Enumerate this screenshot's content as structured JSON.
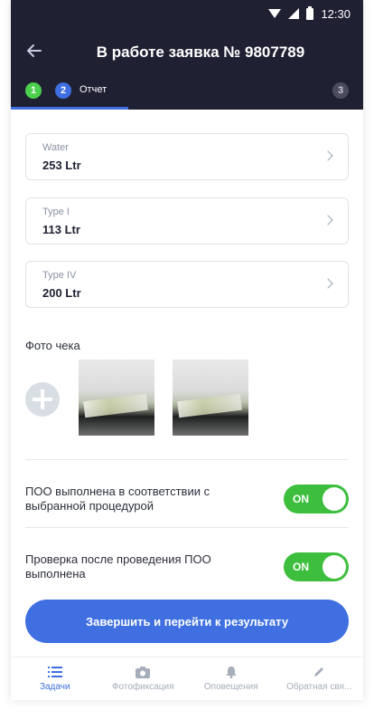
{
  "status_bar": {
    "time": "12:30"
  },
  "header": {
    "title": "В работе заявка № 9807789",
    "steps": [
      {
        "number": "1",
        "state": "done"
      },
      {
        "number": "2",
        "label": "Отчет",
        "state": "active"
      },
      {
        "number": "3",
        "state": "pending"
      }
    ]
  },
  "fields": [
    {
      "label": "Water",
      "value": "253 Ltr"
    },
    {
      "label": "Type I",
      "value": "113 Ltr"
    },
    {
      "label": "Type IV",
      "value": "200 Ltr"
    }
  ],
  "photos": {
    "title": "Фото чека",
    "count": 2
  },
  "toggles": [
    {
      "label": "ПОО  выполнена в соответствии с выбранной процедурой",
      "state": "ON"
    },
    {
      "label": "Проверка после проведения ПОО выполнена",
      "state": "ON"
    }
  ],
  "primary_button": {
    "label": "Завершить и перейти к результату"
  },
  "tabbar": {
    "items": [
      {
        "label": "Задачи",
        "icon": "list-icon",
        "active": true
      },
      {
        "label": "Фотофиксация",
        "icon": "camera-icon",
        "active": false
      },
      {
        "label": "Оповещения",
        "icon": "bell-icon",
        "active": false
      },
      {
        "label": "Обратная свя...",
        "icon": "pencil-icon",
        "active": false
      }
    ]
  },
  "colors": {
    "header_bg": "#1f2133",
    "accent": "#3f6fe0",
    "success": "#4ccf4c",
    "toggle_on": "#3dbf3d"
  }
}
